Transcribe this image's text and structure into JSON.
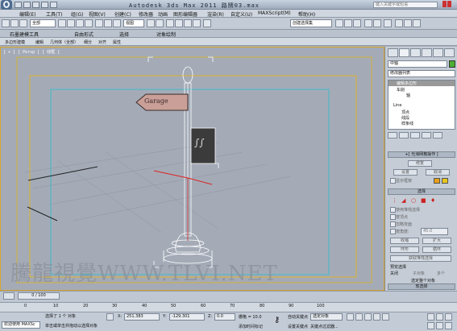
{
  "window": {
    "title": "Autodesk 3ds Max  2011      路牌03.max",
    "search_placeholder": "键入关键字或短语"
  },
  "menu": [
    "编辑(E)",
    "工具(T)",
    "组(G)",
    "视图(V)",
    "创建(C)",
    "修改器",
    "动画",
    "图形编辑器",
    "渲染(R)",
    "自定义(U)",
    "MAXScript(M)",
    "帮助(H)"
  ],
  "toolbar": {
    "filter_value": "全部",
    "view_value": "视图",
    "selection_set_value": "创建选择集"
  },
  "ribbon": {
    "tabs": [
      "石墨建模工具",
      "自由形式",
      "选择",
      "对象绘制"
    ],
    "sub": [
      "多边形建模",
      "编辑",
      "几何体（全部）",
      "细分",
      "对齐",
      "属性"
    ]
  },
  "viewport": {
    "label": "[ + ] [ Persp ] [ 线框 ]",
    "sign_text": "Garage",
    "watermark": "騰龍視覺WWW.TLVI.NET"
  },
  "command_panel": {
    "object_name": "中轴",
    "modifier_list": "修改器列表",
    "stack": [
      "编辑多边形",
      "车削",
      "轴",
      "Line",
      "顶点",
      "线段",
      "样条线"
    ],
    "rollout_soft": "+[  光滑网格操作  ]",
    "btn_fix": "修复",
    "btn_settings": "设置",
    "btn_cancel": "取消",
    "show_check": "显示框架",
    "rollout_select": "选择",
    "checks": [
      "使用堆栈选择",
      "按顶点",
      "忽略背面",
      "按角度:"
    ],
    "angle_value": "45.0",
    "btn_shrink": "收缩",
    "btn_grow": "扩大",
    "btn_ring": "环形",
    "btn_loop": "循环",
    "btn_subobj": "获取堆栈选择",
    "preview_label": "预览选择",
    "radio_off": "关闭",
    "radio_sub": "子对象",
    "radio_multi": "多个",
    "whole_label": "选定整个对象",
    "rollout_soft2": "软选择",
    "accent_color": "#4caf32"
  },
  "timeline": {
    "slider": "0 / 100",
    "ticks": [
      "0",
      "10",
      "20",
      "30",
      "40",
      "50",
      "60",
      "70",
      "80",
      "90",
      "100"
    ]
  },
  "status": {
    "welcome": "欢迎使用 MAXSc",
    "selected": "选择了 1 个 对象",
    "hint": "单击或单击并拖动以选择对象",
    "x_label": "X:",
    "x_value": "251.383",
    "y_label": "Y:",
    "y_value": "-129.301",
    "z_label": "Z:",
    "z_value": "0.0",
    "grid": "栅格 = 10.0",
    "add_time": "添加时间标记",
    "auto_key": "自动关键点",
    "set_key": "设置关键点",
    "sel_obj": "选定对象",
    "key_filter": "关键点过滤器..."
  }
}
